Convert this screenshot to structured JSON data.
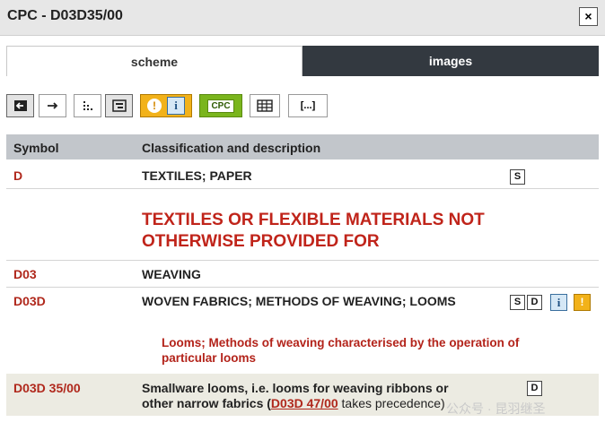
{
  "window": {
    "title": "CPC - D03D35/00",
    "close_symbol": "×"
  },
  "tabs": [
    {
      "label": "scheme",
      "active": true
    },
    {
      "label": "images",
      "active": false
    }
  ],
  "toolbar": {
    "cpc_label": "CPC",
    "ellipsis_label": "[...]",
    "info_symbol": "i",
    "warn_symbol": "!"
  },
  "table": {
    "header": {
      "symbol": "Symbol",
      "description": "Classification and description"
    },
    "rows": [
      {
        "symbol": "D",
        "description": "TEXTILES; PAPER"
      },
      {
        "symbol": "D03",
        "description": "WEAVING"
      },
      {
        "symbol": "D03D",
        "description": "WOVEN FABRICS; METHODS OF WEAVING; LOOMS"
      },
      {
        "symbol": "D03D 35/00",
        "description_line1": "Smallware looms, i.e. looms for weaving ribbons or",
        "description_line2_prefix": "other narrow fabrics (",
        "description_link": "D03D 47/00",
        "description_line2_suffix": " takes precedence)"
      }
    ],
    "section_title": "TEXTILES OR FLEXIBLE MATERIALS NOT OTHERWISE PROVIDED FOR",
    "group_note": "Looms; Methods of weaving characterised by the operation of particular looms"
  },
  "icon_labels": {
    "s": "S",
    "d": "D",
    "i": "i",
    "warn": "!"
  },
  "watermark": "公众号 · 昆羽继圣",
  "colors": {
    "symbol_red": "#b0281c",
    "header_gray": "#c2c6cb",
    "tab_dark": "#333940",
    "cpc_green": "#7ab51d",
    "warn_orange": "#f2b21a"
  }
}
